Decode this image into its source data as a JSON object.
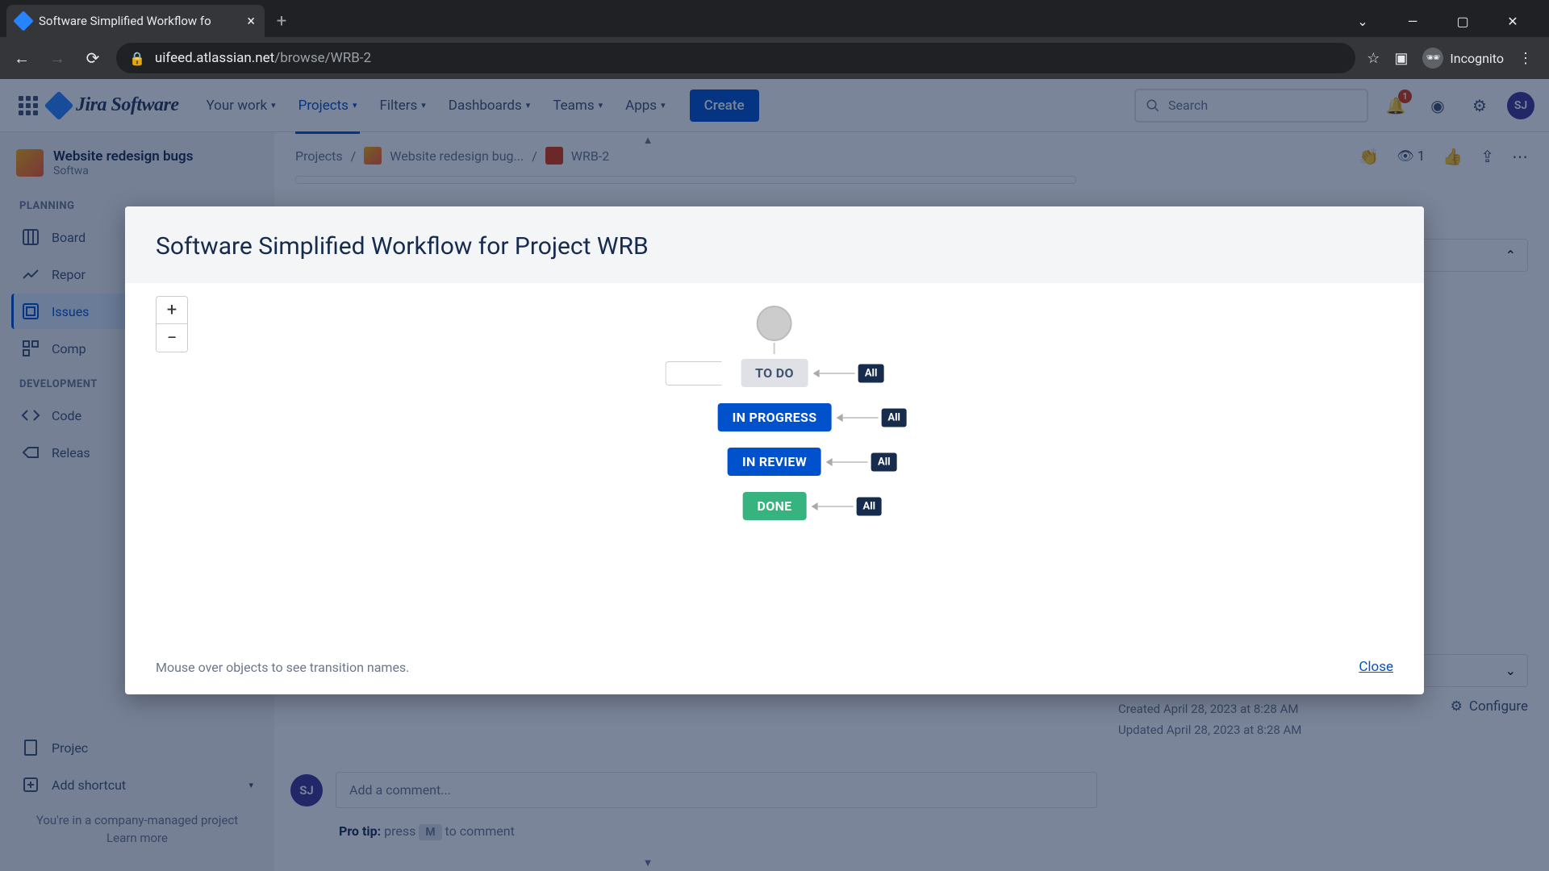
{
  "browser": {
    "tab_title": "Software Simplified Workflow fo",
    "url_domain": "uifeed.atlassian.net",
    "url_path": "/browse/WRB-2",
    "incognito_label": "Incognito"
  },
  "header": {
    "product": "Jira Software",
    "nav": {
      "your_work": "Your work",
      "projects": "Projects",
      "filters": "Filters",
      "dashboards": "Dashboards",
      "teams": "Teams",
      "apps": "Apps"
    },
    "create_label": "Create",
    "search_placeholder": "Search",
    "notification_badge": "1",
    "avatar_initials": "SJ"
  },
  "sidebar": {
    "project_name": "Website redesign bugs",
    "project_type": "Softwa",
    "section_planning": "PLANNING",
    "section_development": "DEVELOPMENT",
    "items": {
      "board": "Board",
      "reports": "Repor",
      "issues": "Issues",
      "components": "Comp",
      "code": "Code",
      "releases": "Releas",
      "project": "Projec",
      "add_shortcut": "Add shortcut"
    },
    "footer_line": "You're in a company-managed project",
    "footer_link": "Learn more"
  },
  "breadcrumb": {
    "projects": "Projects",
    "project_name": "Website redesign bug...",
    "issue_key": "WRB-2"
  },
  "issue_actions": {
    "watch_count": "1"
  },
  "comment": {
    "avatar": "SJ",
    "placeholder": "Add a comment...",
    "pro_tip_label": "Pro tip:",
    "pro_tip_press": "press",
    "pro_tip_key": "M",
    "pro_tip_suffix": "to comment"
  },
  "details": {
    "created": "Created April 28, 2023 at 8:28 AM",
    "updated": "Updated April 28, 2023 at 8:28 AM",
    "configure": "Configure"
  },
  "modal": {
    "title": "Software Simplified Workflow for Project WRB",
    "zoom_in": "+",
    "zoom_out": "−",
    "statuses": {
      "todo": "TO DO",
      "in_progress": "IN PROGRESS",
      "in_review": "IN REVIEW",
      "done": "DONE"
    },
    "all_label": "All",
    "hint": "Mouse over objects to see transition names.",
    "close": "Close"
  }
}
